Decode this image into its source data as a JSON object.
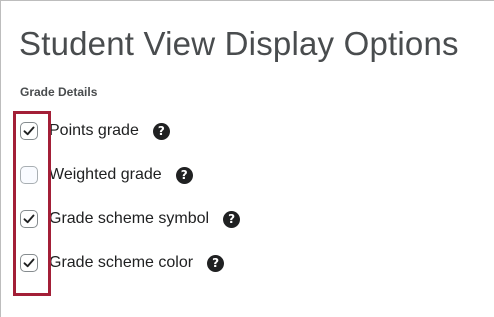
{
  "page": {
    "title": "Student View Display Options"
  },
  "grade_details": {
    "heading": "Grade Details",
    "options": [
      {
        "label": "Points grade",
        "checked": true,
        "help_icon": "question-circle-icon"
      },
      {
        "label": "Weighted grade",
        "checked": false,
        "help_icon": "question-circle-icon"
      },
      {
        "label": "Grade scheme symbol",
        "checked": true,
        "help_icon": "question-circle-icon"
      },
      {
        "label": "Grade scheme color",
        "checked": true,
        "help_icon": "question-circle-icon"
      }
    ]
  },
  "icons": {
    "check": "check-icon",
    "help": "question-circle-icon"
  },
  "colors": {
    "highlight": "#a31f37",
    "text": "#202122",
    "title": "#494c4e"
  }
}
